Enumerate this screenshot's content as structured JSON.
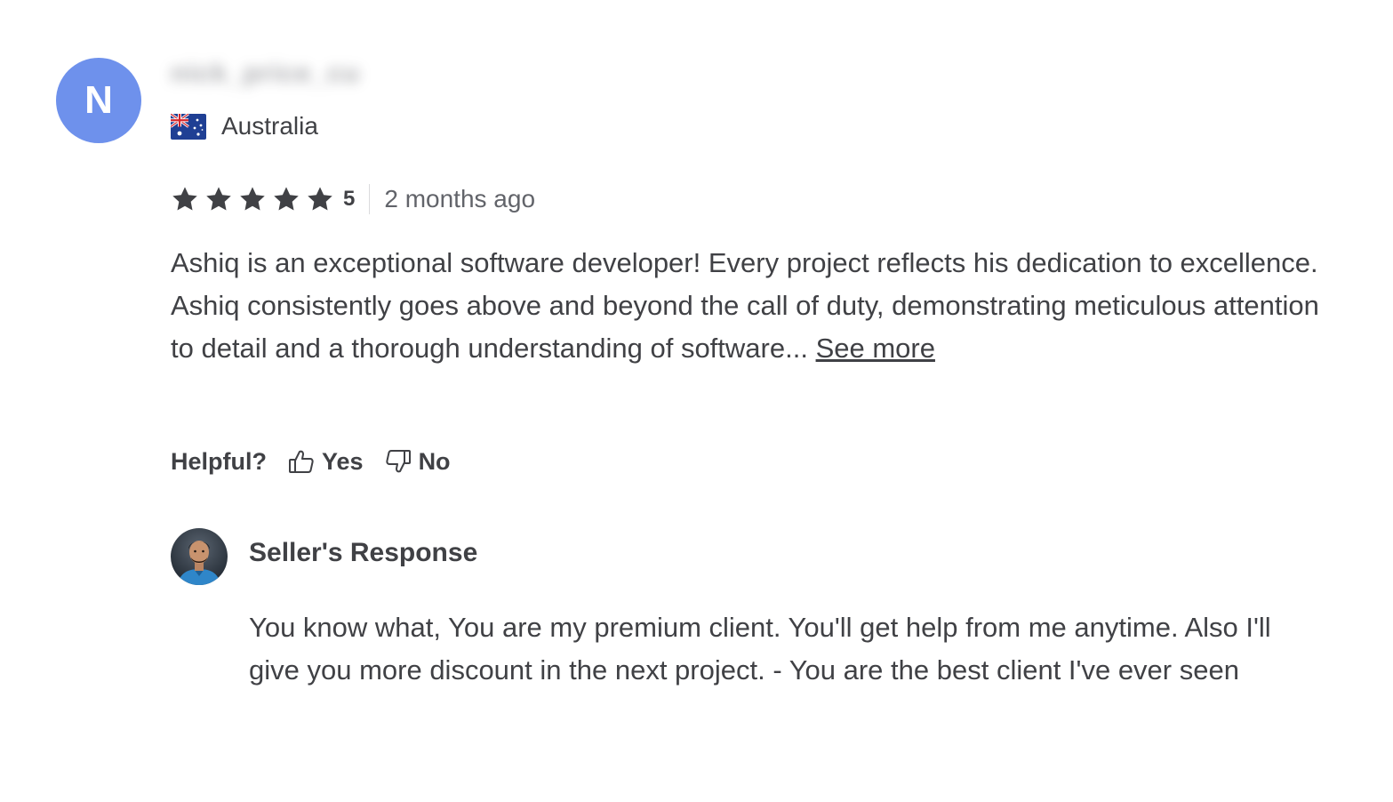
{
  "reviewer": {
    "avatar_initial": "N",
    "avatar_color": "#6e91ec",
    "username": "nick_price_cu",
    "country": "Australia",
    "flag_icon": "australia-flag-icon"
  },
  "rating": {
    "stars": 5,
    "value": "5",
    "star_color": "#404145",
    "time_ago": "2 months ago"
  },
  "review": {
    "text": "Ashiq is an exceptional software developer! Every project reflects his dedication to excellence. Ashiq consistently goes above and beyond the call of duty, demonstrating meticulous attention to detail and a thorough understanding of software...",
    "see_more_label": "See more"
  },
  "helpful": {
    "question": "Helpful?",
    "yes_label": "Yes",
    "no_label": "No",
    "yes_icon": "thumbs-up-icon",
    "no_icon": "thumbs-down-icon"
  },
  "seller_response": {
    "title": "Seller's Response",
    "text": "You know what, You are my premium client. You'll get help from me anytime. Also I'll give you more discount in the next project. - You are the best client I've ever seen"
  }
}
